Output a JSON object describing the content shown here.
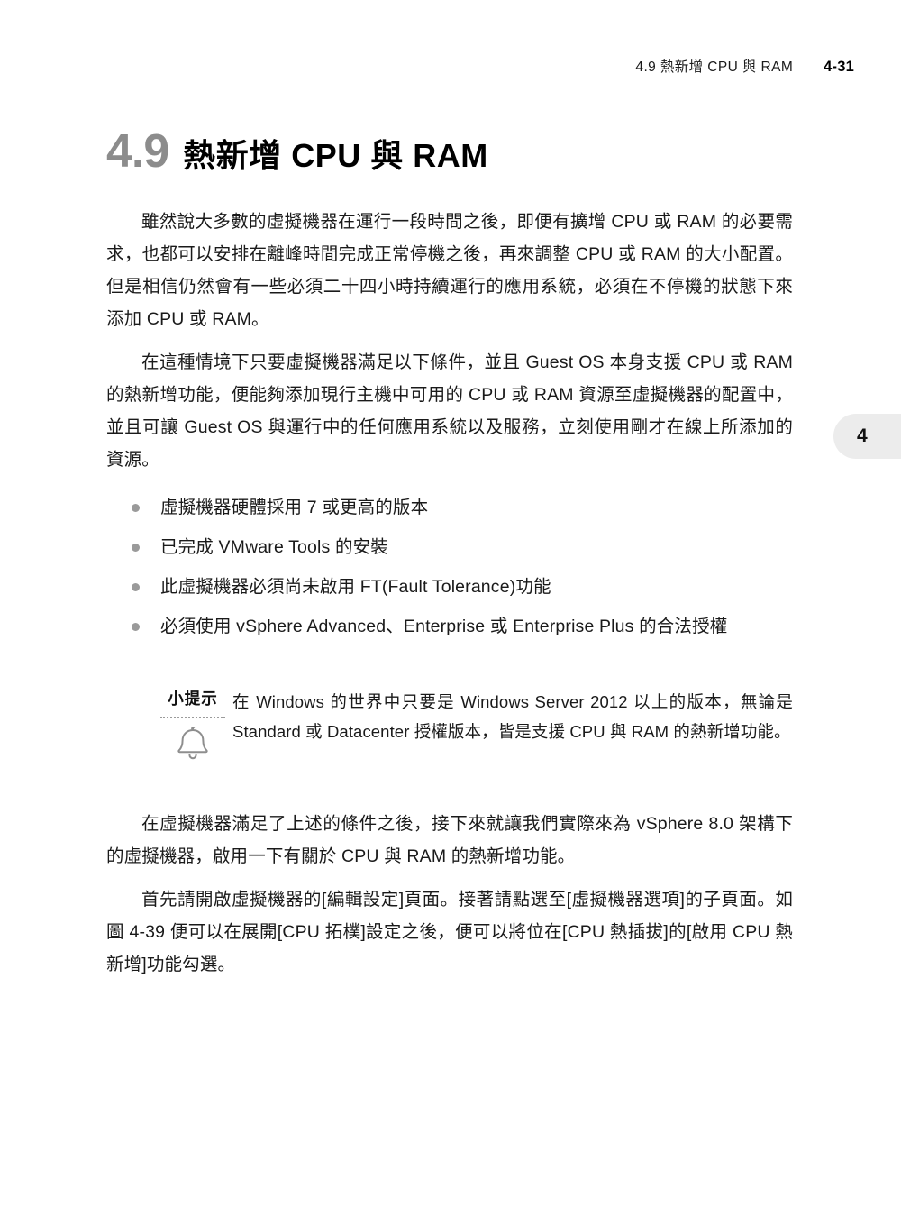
{
  "header": {
    "title": "4.9 熱新增 CPU 與 RAM",
    "page_number": "4-31"
  },
  "section": {
    "number": "4.9",
    "name": "熱新增 CPU 與 RAM"
  },
  "paragraphs": {
    "p1": "雖然說大多數的虛擬機器在運行一段時間之後，即便有擴增 CPU 或 RAM 的必要需求，也都可以安排在離峰時間完成正常停機之後，再來調整 CPU 或 RAM 的大小配置。但是相信仍然會有一些必須二十四小時持續運行的應用系統，必須在不停機的狀態下來添加 CPU 或 RAM。",
    "p2": "在這種情境下只要虛擬機器滿足以下條件，並且 Guest OS 本身支援 CPU 或 RAM 的熱新增功能，便能夠添加現行主機中可用的 CPU 或 RAM 資源至虛擬機器的配置中，並且可讓 Guest OS 與運行中的任何應用系統以及服務，立刻使用剛才在線上所添加的資源。",
    "p3": "在虛擬機器滿足了上述的條件之後，接下來就讓我們實際來為 vSphere 8.0 架構下的虛擬機器，啟用一下有關於 CPU 與 RAM 的熱新增功能。",
    "p4": "首先請開啟虛擬機器的[編輯設定]頁面。接著請點選至[虛擬機器選項]的子頁面。如圖 4-39 便可以在展開[CPU 拓樸]設定之後，便可以將位在[CPU 熱插拔]的[啟用 CPU 熱新增]功能勾選。"
  },
  "bullets": [
    {
      "text": "虛擬機器硬體採用 7 或更高的版本"
    },
    {
      "text": "已完成 VMware Tools 的安裝"
    },
    {
      "text": "此虛擬機器必須尚未啟用 FT(Fault Tolerance)功能"
    },
    {
      "text": "必須使用 vSphere Advanced、Enterprise 或 Enterprise Plus 的合法授權"
    }
  ],
  "tip": {
    "label": "小提示",
    "icon": "bell-icon",
    "body": "在 Windows 的世界中只要是 Windows Server 2012 以上的版本，無論是 Standard 或 Datacenter 授權版本，皆是支援 CPU 與 RAM 的熱新增功能。"
  },
  "chapter_tab": {
    "number": "4"
  },
  "colors": {
    "section_number": "#8c8c8c",
    "bullet": "#9a9a9a",
    "tab_background": "#ececec",
    "text": "#1a1a1a"
  }
}
